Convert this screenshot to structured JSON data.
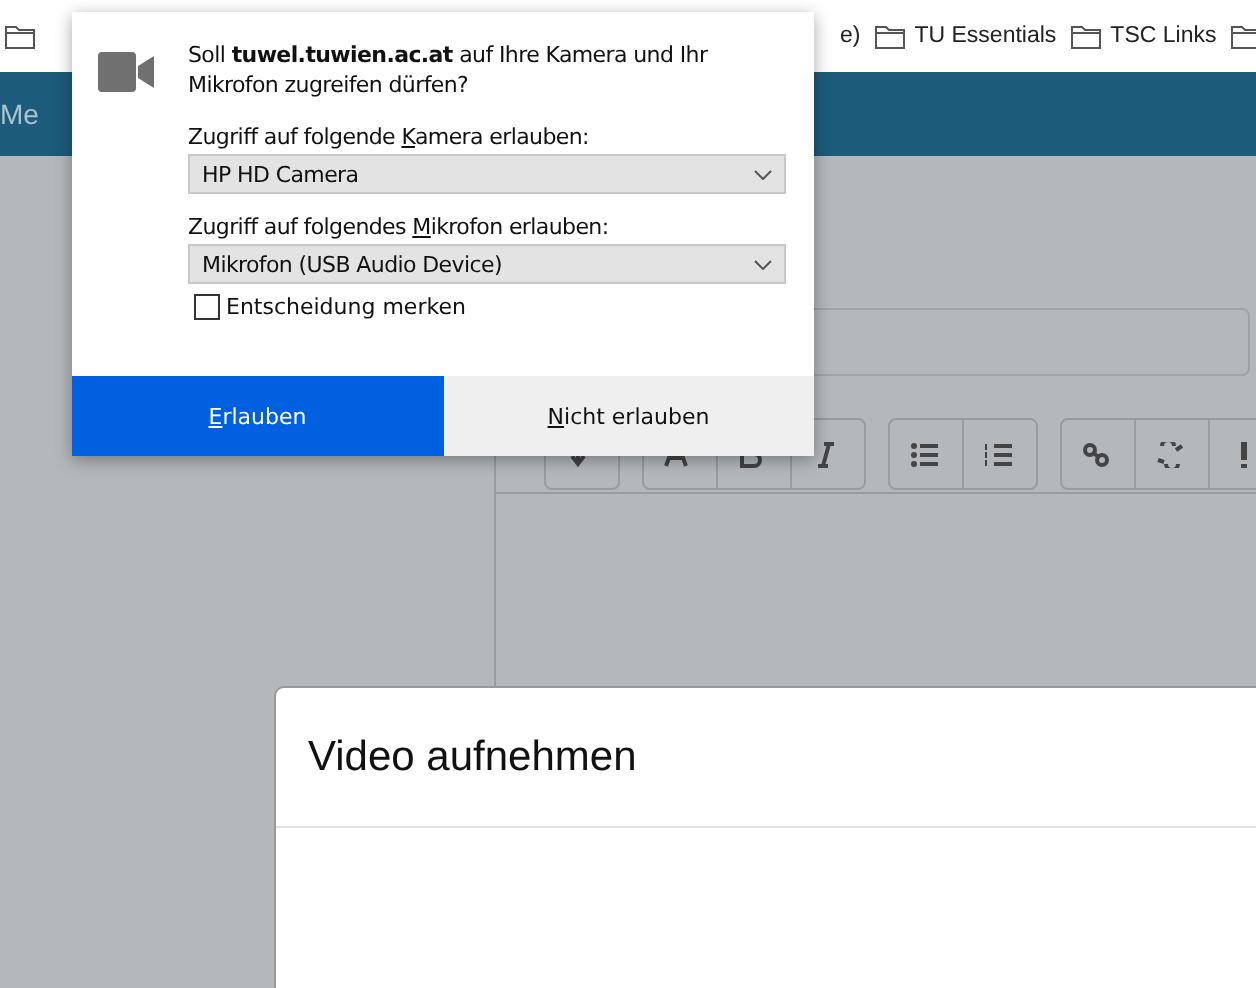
{
  "bookmarks": [
    {
      "label": "e)"
    },
    {
      "label": "TU Essentials"
    },
    {
      "label": "TSC Links"
    }
  ],
  "header": {
    "title": "Me"
  },
  "permission_popup": {
    "message": "Soll **tuwel.tuwien.ac.at** auf Ihre Kamera und Ihr Mikrofon zugreifen dürfen?",
    "selects": [
      {
        "label": {
          "before": "Zugriff auf folgende ",
          "key": "K",
          "after": "amera erlauben:"
        },
        "value": "HP HD Camera"
      },
      {
        "label": {
          "before": "Zugriff auf folgendes ",
          "key": "M",
          "after": "ikrofon erlauben:"
        },
        "value": "Mikrofon (USB Audio Device)"
      }
    ],
    "remember": {
      "label": "Entscheidung merken",
      "checked": false
    },
    "buttons": [
      {
        "kind": "primary",
        "label": {
          "key": "E",
          "after": "rlauben"
        }
      },
      {
        "kind": "secondary",
        "label": {
          "key": "N",
          "after": "icht erlauben"
        }
      }
    ]
  },
  "modal": {
    "title": "Video aufnehmen"
  }
}
